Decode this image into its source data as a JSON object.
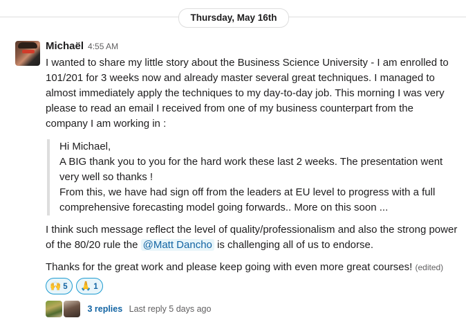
{
  "date_divider": "Thursday, May 16th",
  "message": {
    "author": "Michaël",
    "time": "4:55 AM",
    "paragraph1": "I wanted to share my little story about the Business Science University - I am enrolled to 101/201 for 3 weeks now and already master several great techniques. I managed to almost immediately apply the techniques to my day-to-day job. This morning I was very please to read an email I received from one of my business counterpart from the company I am working in :",
    "quote": {
      "line1": "Hi Michael,",
      "line2": "A BIG thank you to you for the hard work these last 2 weeks. The presentation went very well so thanks !",
      "line3": "From this, we have had sign off from the leaders at EU level to progress with a full comprehensive forecasting model going forwards.. More on this soon ..."
    },
    "paragraph2_before": "I think such message reflect the level of quality/professionalism and also the strong power of the 80/20 rule the ",
    "mention": "@Matt Dancho",
    "paragraph2_after": " is challenging all of us to endorse.",
    "paragraph3": "Thanks for the great work and please keep going with even more great courses!",
    "edited": "(edited)"
  },
  "reactions": [
    {
      "emoji": "🙌",
      "icon": "raised-hands",
      "count": "5"
    },
    {
      "emoji": "🙏",
      "icon": "folded-hands",
      "count": "1"
    }
  ],
  "thread": {
    "replies": "3 replies",
    "last_reply": "Last reply 5 days ago"
  },
  "colors": {
    "link": "#1264a3",
    "mention_bg": "#e8f5fa",
    "reaction_border": "#1d9bd1"
  }
}
